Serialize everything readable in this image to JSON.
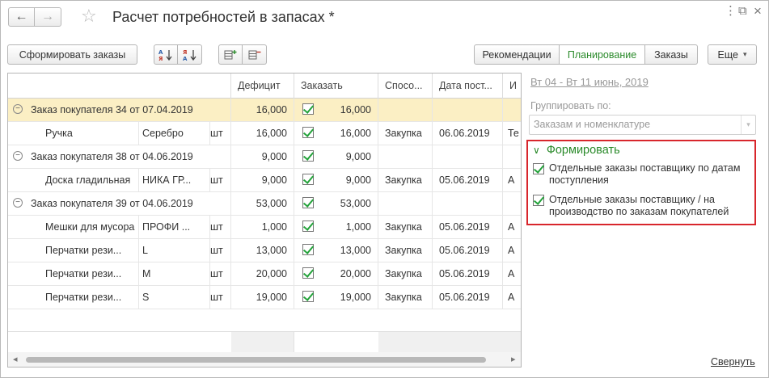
{
  "window": {
    "title": "Расчет потребностей в запасах *",
    "nav_back": "←",
    "nav_forward": "→",
    "star": "☆",
    "menu_icon": "⋮",
    "restore_icon": "⧉",
    "close_icon": "×"
  },
  "toolbar": {
    "create_orders": "Сформировать заказы",
    "sort_asc_icon": "А↓Я",
    "sort_desc_icon": "Я↓А",
    "group_icon_1": "▦+",
    "group_icon_2": "▦−",
    "tabs": [
      {
        "label": "Рекомендации",
        "active": false
      },
      {
        "label": "Планирование",
        "active": true
      },
      {
        "label": "Заказы",
        "active": false
      }
    ],
    "more": "Еще",
    "more_arrow": "▾"
  },
  "table": {
    "headers": [
      "",
      "",
      "",
      "Дефицит",
      "Заказать",
      "Спосо...",
      "Дата пост...",
      "И"
    ],
    "rows": [
      {
        "type": "group",
        "text": "Заказ покупателя 34 от 07.04.2019",
        "deficit": "16,000",
        "order": "16,000",
        "selected": true
      },
      {
        "type": "item",
        "name": "Ручка",
        "char": "Серебро",
        "unit": "шт",
        "deficit": "16,000",
        "order": "16,000",
        "method": "Закупка",
        "date": "06.06.2019",
        "extra": "Те"
      },
      {
        "type": "group",
        "text": "Заказ покупателя 38 от 04.06.2019",
        "deficit": "9,000",
        "order": "9,000",
        "selected": false
      },
      {
        "type": "item",
        "name": "Доска гладильная",
        "char": "НИКА ГР...",
        "unit": "шт",
        "deficit": "9,000",
        "order": "9,000",
        "method": "Закупка",
        "date": "05.06.2019",
        "extra": "А"
      },
      {
        "type": "group",
        "text": "Заказ покупателя 39 от 04.06.2019",
        "deficit": "53,000",
        "order": "53,000",
        "selected": false
      },
      {
        "type": "item",
        "name": "Мешки для мусора",
        "char": "ПРОФИ ...",
        "unit": "шт",
        "deficit": "1,000",
        "order": "1,000",
        "method": "Закупка",
        "date": "05.06.2019",
        "extra": "А"
      },
      {
        "type": "item",
        "name": "Перчатки рези...",
        "char": "L",
        "unit": "шт",
        "deficit": "13,000",
        "order": "13,000",
        "method": "Закупка",
        "date": "05.06.2019",
        "extra": "А"
      },
      {
        "type": "item",
        "name": "Перчатки рези...",
        "char": "M",
        "unit": "шт",
        "deficit": "20,000",
        "order": "20,000",
        "method": "Закупка",
        "date": "05.06.2019",
        "extra": "А"
      },
      {
        "type": "item",
        "name": "Перчатки рези...",
        "char": "S",
        "unit": "шт",
        "deficit": "19,000",
        "order": "19,000",
        "method": "Закупка",
        "date": "05.06.2019",
        "extra": "А"
      }
    ],
    "group_toggle": "−",
    "scroll_left": "◂",
    "scroll_right": "▸"
  },
  "panel": {
    "period": "Вт 04 - Вт 11 июнь, 2019",
    "group_by_label": "Группировать по:",
    "group_by_value": "Заказам и номенклатуре",
    "group_by_arrow": "▾",
    "form_title": "Формировать",
    "form_chevron": "∨",
    "options": [
      "Отдельные заказы поставщику по датам поступления",
      "Отдельные заказы поставщику / на производство по заказам покупателей"
    ],
    "collapse": "Свернуть"
  },
  "colors": {
    "accent_green": "#2a8a2a",
    "highlight_red": "#d8262c",
    "selected_row": "#fbefc4"
  }
}
